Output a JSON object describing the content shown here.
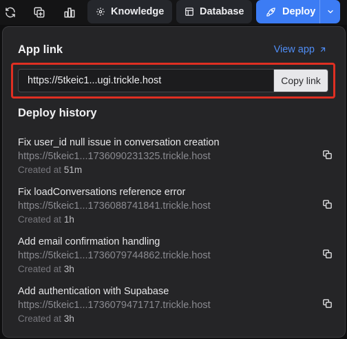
{
  "toolbar": {
    "icons": [
      "refresh-icon",
      "add-copy-icon",
      "analytics-icon"
    ],
    "knowledge_label": "Knowledge",
    "database_label": "Database",
    "deploy_label": "Deploy"
  },
  "panel": {
    "app_link_heading": "App link",
    "view_app_label": "View app",
    "app_url": "https://5tkeic1...ugi.trickle.host",
    "copy_label": "Copy link",
    "history_heading": "Deploy history",
    "created_prefix": "Created at",
    "deployments": [
      {
        "title": "Fix user_id null issue in conversation creation",
        "url": "https://5tkeic1...1736090231325.trickle.host",
        "time": "51m"
      },
      {
        "title": "Fix loadConversations reference error",
        "url": "https://5tkeic1...1736088741841.trickle.host",
        "time": "1h"
      },
      {
        "title": "Add email confirmation handling",
        "url": "https://5tkeic1...1736079744862.trickle.host",
        "time": "3h"
      },
      {
        "title": "Add authentication with Supabase",
        "url": "https://5tkeic1...1736079471717.trickle.host",
        "time": "3h"
      }
    ]
  },
  "colors": {
    "accent": "#3c7cf4",
    "link": "#4f8df5",
    "highlight": "#e02f22",
    "panel_bg": "#252527"
  }
}
